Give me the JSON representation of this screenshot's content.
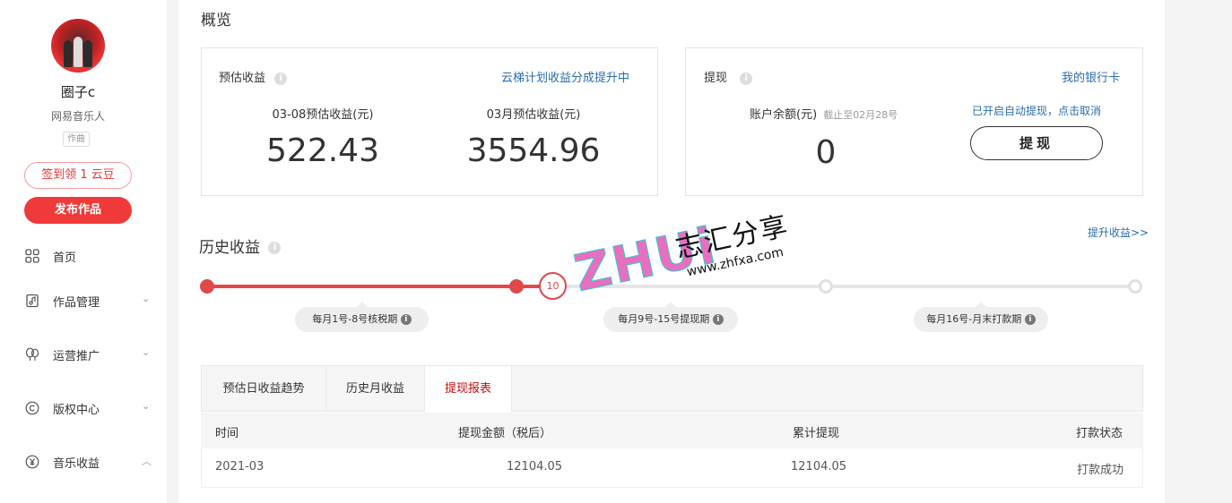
{
  "sidebar": {
    "user_name": "圈子c",
    "user_role": "网易音乐人",
    "user_tag": "作曲",
    "checkin_label": "签到领 1 云豆",
    "publish_label": "发布作品",
    "nav": [
      {
        "label": "首页",
        "icon": "grid-icon"
      },
      {
        "label": "作品管理",
        "icon": "music-file-icon"
      },
      {
        "label": "运营推广",
        "icon": "balloon-icon"
      },
      {
        "label": "版权中心",
        "icon": "copyright-icon"
      },
      {
        "label": "音乐收益",
        "icon": "yuan-icon"
      }
    ]
  },
  "overview": {
    "title": "概览",
    "estimate": {
      "title": "预估收益",
      "link": "云梯计划收益分成提升中",
      "stats": [
        {
          "label": "03-08预估收益(元)",
          "value": "522.43"
        },
        {
          "label": "03月预估收益(元)",
          "value": "3554.96"
        }
      ]
    },
    "withdraw": {
      "title": "提现",
      "link": "我的银行卡",
      "balance_label": "账户余额(元)",
      "balance_note": "截止至02月28号",
      "balance_value": "0",
      "auto_note": "已开启自动提现，点击取消",
      "button": "提现"
    }
  },
  "history": {
    "title": "历史收益",
    "link": "提升收益>>",
    "current_day": "10",
    "phases": [
      "每月1号-8号核税期",
      "每月9号-15号提现期",
      "每月16号-月末打款期"
    ]
  },
  "tabs": [
    "预估日收益趋势",
    "历史月收益",
    "提现报表"
  ],
  "active_tab": 2,
  "table": {
    "columns": [
      "时间",
      "提现金额（税后）",
      "累计提现",
      "打款状态"
    ],
    "rows": [
      [
        "2021-03",
        "12104.05",
        "12104.05",
        "打款成功"
      ]
    ]
  },
  "watermark": {
    "brand": "ZHUi",
    "cn": "志汇分享",
    "url": "www.zhfxa.com"
  },
  "colors": {
    "accent": "#f03a3a",
    "link": "#2b6cb0",
    "active_tab": "#c20c0c",
    "timeline_done": "#e0484a"
  }
}
